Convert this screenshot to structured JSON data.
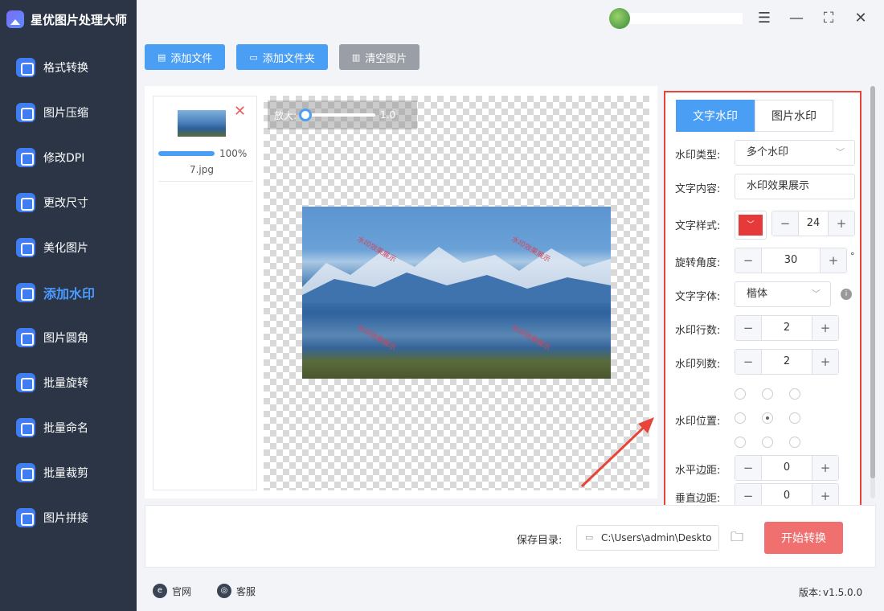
{
  "app": {
    "title": "星优图片处理大师"
  },
  "sidebar": {
    "items": [
      {
        "label": "格式转换",
        "icon": "format-convert-icon"
      },
      {
        "label": "图片压缩",
        "icon": "compress-icon"
      },
      {
        "label": "修改DPI",
        "icon": "dpi-icon"
      },
      {
        "label": "更改尺寸",
        "icon": "resize-icon"
      },
      {
        "label": "美化图片",
        "icon": "beautify-icon"
      },
      {
        "label": "添加水印",
        "icon": "watermark-icon"
      },
      {
        "label": "图片圆角",
        "icon": "round-corner-icon"
      },
      {
        "label": "批量旋转",
        "icon": "rotate-icon"
      },
      {
        "label": "批量命名",
        "icon": "rename-icon"
      },
      {
        "label": "批量裁剪",
        "icon": "crop-icon"
      },
      {
        "label": "图片拼接",
        "icon": "stitch-icon"
      }
    ],
    "active_index": 5
  },
  "toolbar": {
    "add_file": "添加文件",
    "add_folder": "添加文件夹",
    "clear": "清空图片"
  },
  "file": {
    "name": "7.jpg",
    "progress_text": "100%",
    "progress": 100
  },
  "preview": {
    "zoom_label": "放大:",
    "zoom_value": "1.0",
    "watermark_text": "水印效果展示"
  },
  "panel": {
    "tab_text": "文字水印",
    "tab_image": "图片水印",
    "type_label": "水印类型:",
    "type_value": "多个水印",
    "content_label": "文字内容:",
    "content_value": "水印效果展示",
    "style_label": "文字样式:",
    "font_size": "24",
    "color": "#e63a3a",
    "rotate_label": "旋转角度:",
    "rotate_value": "30",
    "rotate_unit": "°",
    "font_label": "文字字体:",
    "font_value": "楷体",
    "rows_label": "水印行数:",
    "rows_value": "2",
    "cols_label": "水印列数:",
    "cols_value": "2",
    "position_label": "水印位置:",
    "position_selected": 4,
    "hmargin_label": "水平边距:",
    "hmargin_value": "0",
    "vmargin_label": "垂直边距:",
    "vmargin_value": "0"
  },
  "save": {
    "label": "保存目录:",
    "path": "C:\\Users\\admin\\Deskto",
    "start": "开始转换"
  },
  "footer": {
    "website": "官网",
    "service": "客服",
    "version_label": "版本:",
    "version": "v1.5.0.0"
  },
  "colors": {
    "accent": "#4a9ff5",
    "sidebar": "#2b3546",
    "start": "#f07070",
    "highlight": "#e8443a"
  }
}
